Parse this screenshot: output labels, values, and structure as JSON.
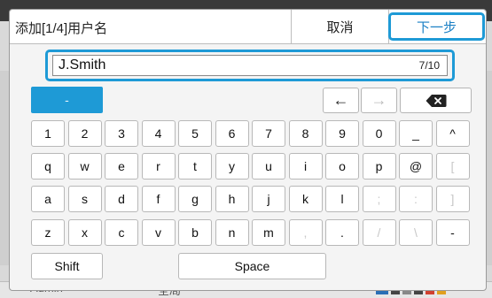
{
  "dialog": {
    "title": "添加[1/4]用户名",
    "cancel_label": "取消",
    "next_label": "下一步"
  },
  "input": {
    "value": "J.Smith",
    "counter": "7/10"
  },
  "mode_key": "-",
  "nav": {
    "left": "←",
    "right": "→",
    "backspace": "⌫"
  },
  "rows": [
    [
      "1",
      "2",
      "3",
      "4",
      "5",
      "6",
      "7",
      "8",
      "9",
      "0",
      "_",
      "^"
    ],
    [
      "q",
      "w",
      "e",
      "r",
      "t",
      "y",
      "u",
      "i",
      "o",
      "p",
      "@",
      "["
    ],
    [
      "a",
      "s",
      "d",
      "f",
      "g",
      "h",
      "j",
      "k",
      "l",
      ";",
      ":",
      "]"
    ],
    [
      "z",
      "x",
      "c",
      "v",
      "b",
      "n",
      "m",
      ",",
      ".",
      "/",
      "\\",
      "-"
    ]
  ],
  "disabled_keys": [
    "[",
    ";",
    ":",
    "]",
    ",",
    "/",
    "\\"
  ],
  "shift_label": "Shift",
  "space_label": "Space",
  "background": {
    "bottom_left": "Admin",
    "bottom_mid": "全局"
  },
  "colors": {
    "accent": "#1e9ad6",
    "key_bg": "#ffffff",
    "dialog_bg": "#f4f4f4"
  }
}
